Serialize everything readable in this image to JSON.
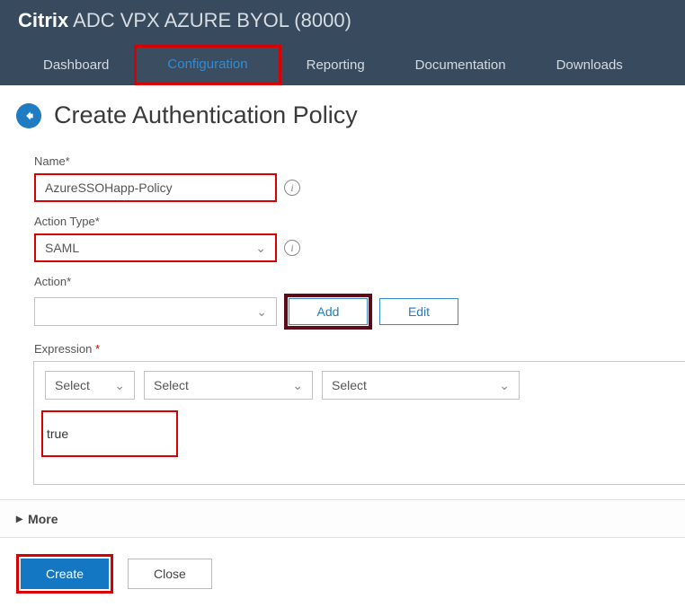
{
  "brand": {
    "strong": "Citrix",
    "light": " ADC VPX AZURE BYOL (8000)"
  },
  "tabs": {
    "dashboard": "Dashboard",
    "configuration": "Configuration",
    "reporting": "Reporting",
    "documentation": "Documentation",
    "downloads": "Downloads"
  },
  "page": {
    "title": "Create Authentication Policy"
  },
  "form": {
    "name_label": "Name*",
    "name_value": "AzureSSOHapp-Policy",
    "action_type_label": "Action Type*",
    "action_type_value": "SAML",
    "action_label": "Action*",
    "action_value": "",
    "add_btn": "Add",
    "edit_btn": "Edit",
    "expression_label": "Expression",
    "expr_select1": "Select",
    "expr_select2": "Select",
    "expr_select3": "Select",
    "expr_value": "true",
    "more": "More",
    "create": "Create",
    "close": "Close"
  },
  "glyph": {
    "chevron_down": "⌄",
    "triangle_right": "▸",
    "info": "i",
    "asterisk": "*"
  }
}
